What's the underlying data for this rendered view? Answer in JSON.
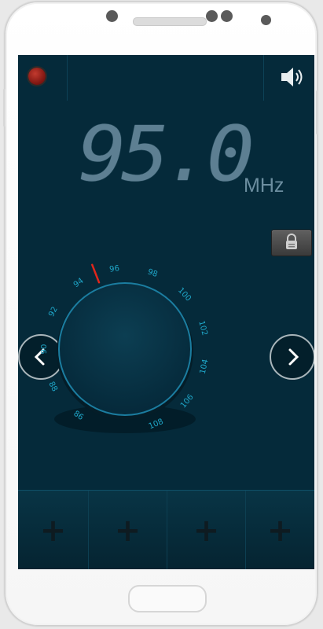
{
  "radio": {
    "frequency": "95.0",
    "unit": "MHz",
    "dial_labels": [
      "86",
      "88",
      "90",
      "92",
      "94",
      "96",
      "98",
      "100",
      "102",
      "104",
      "106",
      "108"
    ],
    "preset_label": "+"
  },
  "icons": {
    "record": "record-icon",
    "volume": "speaker-icon",
    "lock": "lock-icon",
    "prev": "chevron-left-icon",
    "next": "chevron-right-icon"
  },
  "colors": {
    "screen_bg": "#052a3a",
    "tick_text": "#1fa6c8",
    "pointer": "#e0261b",
    "display_text": "#5d7f92"
  }
}
